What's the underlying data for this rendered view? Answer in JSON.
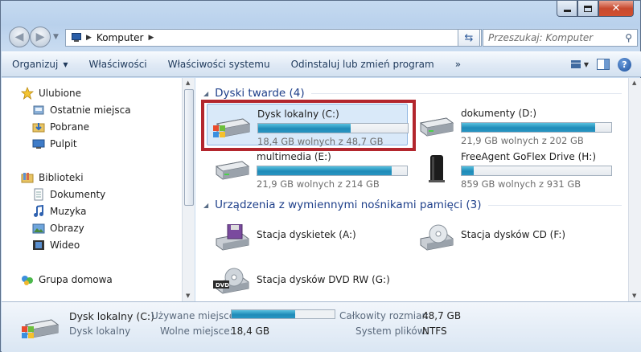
{
  "window": {
    "location": "Komputer",
    "search_placeholder": "Przeszukaj: Komputer"
  },
  "toolbar": {
    "items": [
      "Organizuj",
      "Właściwości",
      "Właściwości systemu",
      "Odinstaluj lub zmień program",
      "»"
    ]
  },
  "nav": {
    "favorites": {
      "label": "Ulubione",
      "items": [
        "Ostatnie miejsca",
        "Pobrane",
        "Pulpit"
      ]
    },
    "libraries": {
      "label": "Biblioteki",
      "items": [
        "Dokumenty",
        "Muzyka",
        "Obrazy",
        "Wideo"
      ]
    },
    "homegroup": "Grupa domowa"
  },
  "groups": {
    "hard_disks": "Dyski twarde (4)",
    "removable": "Urządzenia z wymiennymi nośnikami pamięci (3)"
  },
  "drives": [
    {
      "name": "Dysk lokalny (C:)",
      "info": "18,4 GB wolnych z 48,7 GB",
      "used_fraction": 0.62
    },
    {
      "name": "dokumenty (D:)",
      "info": "21,9 GB wolnych z 202 GB",
      "used_fraction": 0.89
    },
    {
      "name": "multimedia (E:)",
      "info": "21,9 GB wolnych z 214 GB",
      "used_fraction": 0.9
    },
    {
      "name": "FreeAgent GoFlex Drive (H:)",
      "info": "859 GB wolnych z 931 GB",
      "used_fraction": 0.08
    }
  ],
  "removable": [
    {
      "name": "Stacja dyskietek (A:)"
    },
    {
      "name": "Stacja dysków CD (F:)"
    },
    {
      "name": "Stacja dysków DVD RW (G:)"
    }
  ],
  "details": {
    "title": "Dysk lokalny (C:)",
    "subtitle": "Dysk lokalny",
    "used_label": "Używane miejsce:",
    "used_fraction": 0.62,
    "free_label": "Wolne miejsce:",
    "free_value": "18,4 GB",
    "total_label": "Całkowity rozmiar:",
    "total_value": "48,7 GB",
    "fs_label": "System plików:",
    "fs_value": "NTFS"
  },
  "colors": {
    "highlight": "#b3262d",
    "bar_fill": "#2895c2",
    "group_header": "#1e3f8a"
  }
}
